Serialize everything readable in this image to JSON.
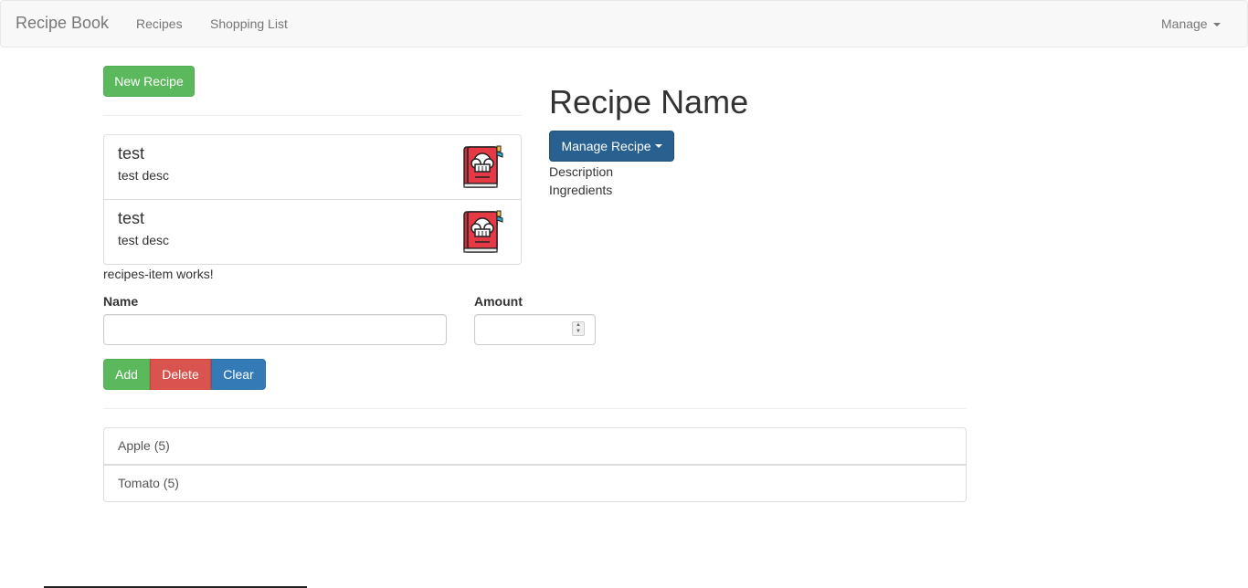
{
  "navbar": {
    "brand": "Recipe Book",
    "links": [
      "Recipes",
      "Shopping List"
    ],
    "manage_label": "Manage"
  },
  "recipes_panel": {
    "new_recipe_label": "New Recipe",
    "items": [
      {
        "name": "test",
        "description": "test desc",
        "image_icon": "chef-cookbook-icon"
      },
      {
        "name": "test",
        "description": "test desc",
        "image_icon": "chef-cookbook-icon"
      }
    ],
    "status_text": "recipes-item works!"
  },
  "recipe_detail": {
    "title": "Recipe Name",
    "manage_label": "Manage Recipe",
    "description_label": "Description",
    "ingredients_label": "Ingredients"
  },
  "shopping_edit": {
    "name_label": "Name",
    "amount_label": "Amount",
    "name_value": "",
    "amount_value": "",
    "add_label": "Add",
    "delete_label": "Delete",
    "clear_label": "Clear"
  },
  "shopping_list": {
    "items": [
      {
        "text": "Apple (5)"
      },
      {
        "text": "Tomato (5)"
      }
    ]
  },
  "colors": {
    "success": "#5cb85c",
    "danger": "#d9534f",
    "primary": "#337ab7",
    "primary_dark": "#286090",
    "cookbook_red": "#e63946"
  }
}
